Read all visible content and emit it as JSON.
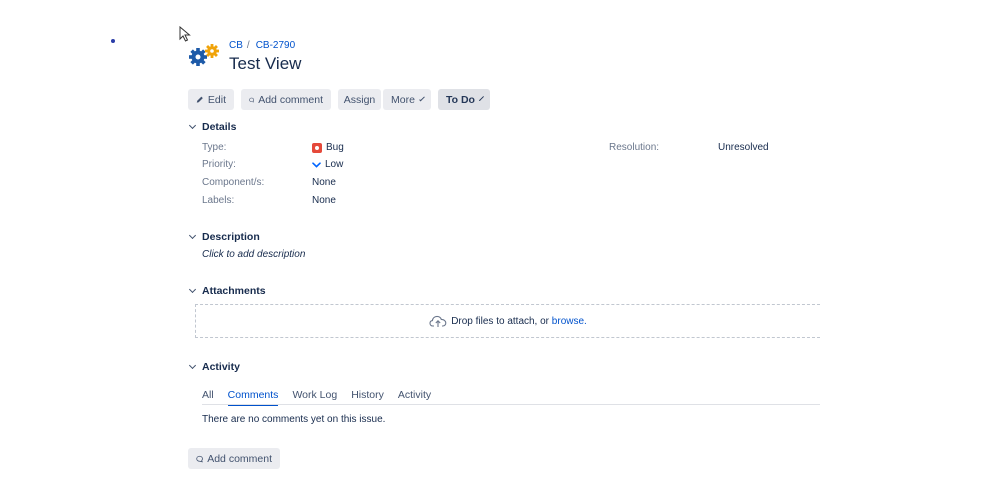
{
  "breadcrumb": {
    "project": "CB",
    "separator": "/",
    "issue_key": "CB-2790"
  },
  "issue": {
    "title": "Test View"
  },
  "toolbar": {
    "edit_label": "Edit",
    "add_comment_label": "Add comment",
    "assign_label": "Assign",
    "more_label": "More",
    "status_label": "To Do"
  },
  "details": {
    "heading": "Details",
    "type_label": "Type:",
    "type_value": "Bug",
    "priority_label": "Priority:",
    "priority_value": "Low",
    "components_label": "Component/s:",
    "components_value": "None",
    "labels_label": "Labels:",
    "labels_value": "None",
    "resolution_label": "Resolution:",
    "resolution_value": "Unresolved"
  },
  "description": {
    "heading": "Description",
    "placeholder": "Click to add description"
  },
  "attachments": {
    "heading": "Attachments",
    "drop_text": "Drop files to attach, or",
    "browse_link": "browse."
  },
  "activity": {
    "heading": "Activity",
    "tabs": [
      "All",
      "Comments",
      "Work Log",
      "History",
      "Activity"
    ],
    "active_tab": "Comments",
    "empty_text": "There are no comments yet on this issue.",
    "add_comment_label": "Add comment"
  },
  "colors": {
    "link": "#0052cc",
    "bug": "#e5493a",
    "text": "#172b4d"
  }
}
